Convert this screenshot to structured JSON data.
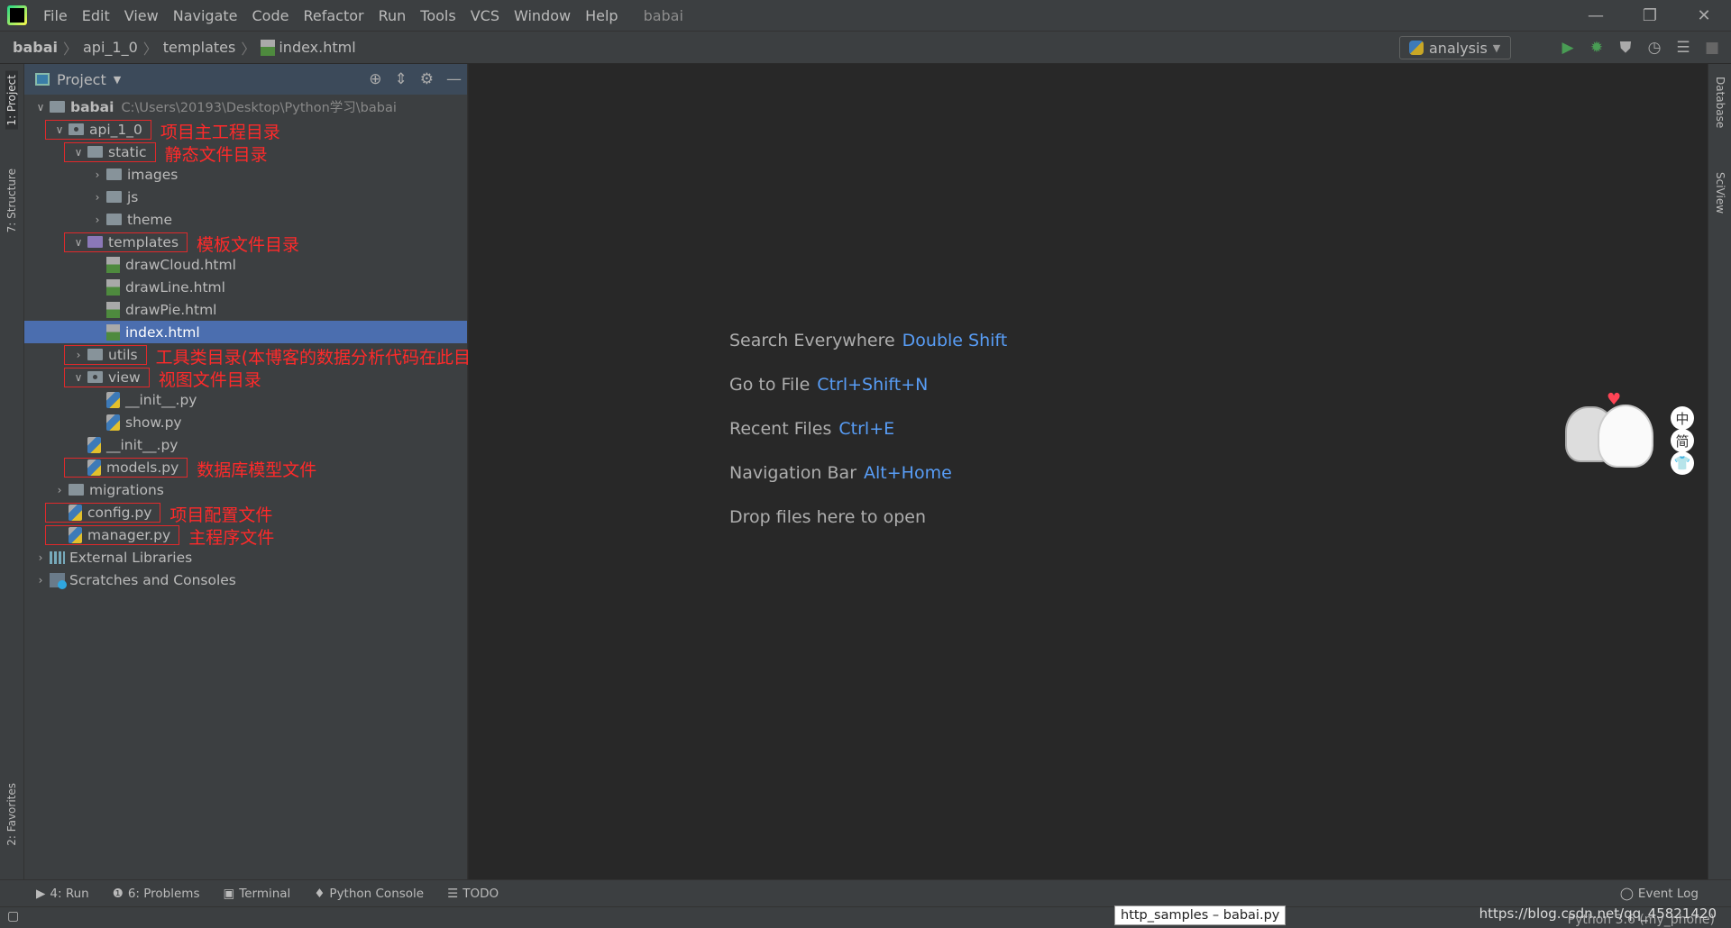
{
  "window": {
    "title": "babai",
    "menus": [
      "File",
      "Edit",
      "View",
      "Navigate",
      "Code",
      "Refactor",
      "Run",
      "Tools",
      "VCS",
      "Window",
      "Help"
    ]
  },
  "breadcrumb": [
    "babai",
    "api_1_0",
    "templates",
    "index.html"
  ],
  "toolbar": {
    "run_config": "analysis"
  },
  "left_stripe": {
    "project": "1: Project",
    "structure": "7: Structure",
    "favorites": "2: Favorites"
  },
  "right_stripe": {
    "database": "Database",
    "sciview": "SciView"
  },
  "project_panel": {
    "title": "Project",
    "root": {
      "name": "babai",
      "path": "C:\\Users\\20193\\Desktop\\Python学习\\babai"
    },
    "rows": [
      {
        "name": "api_1_0",
        "note": "项目主工程目录"
      },
      {
        "name": "static",
        "note": "静态文件目录"
      },
      {
        "name": "images"
      },
      {
        "name": "js"
      },
      {
        "name": "theme"
      },
      {
        "name": "templates",
        "note": "模板文件目录"
      },
      {
        "name": "drawCloud.html"
      },
      {
        "name": "drawLine.html"
      },
      {
        "name": "drawPie.html"
      },
      {
        "name": "index.html"
      },
      {
        "name": "utils",
        "note": "工具类目录(本博客的数据分析代码在此目录的analysis.py文件中)"
      },
      {
        "name": "view",
        "note": "视图文件目录"
      },
      {
        "name": "__init__.py"
      },
      {
        "name": "show.py"
      },
      {
        "name": "__init__.py"
      },
      {
        "name": "models.py",
        "note": "数据库模型文件"
      },
      {
        "name": "migrations"
      },
      {
        "name": "config.py",
        "note": "项目配置文件"
      },
      {
        "name": "manager.py",
        "note": "主程序文件"
      },
      {
        "name": "External Libraries"
      },
      {
        "name": "Scratches and Consoles"
      }
    ]
  },
  "editor": {
    "hints": [
      {
        "label": "Search Everywhere",
        "key": "Double Shift"
      },
      {
        "label": "Go to File",
        "key": "Ctrl+Shift+N"
      },
      {
        "label": "Recent Files",
        "key": "Ctrl+E"
      },
      {
        "label": "Navigation Bar",
        "key": "Alt+Home"
      },
      {
        "label": "Drop files here to open",
        "key": ""
      }
    ]
  },
  "ime": [
    "中",
    "简",
    "👕"
  ],
  "bottom_tools": [
    "4: Run",
    "6: Problems",
    "Terminal",
    "Python Console",
    "TODO"
  ],
  "event_log": "Event Log",
  "status": {
    "tooltip": "http_samples – babai.py",
    "interpreter": "Python 3.6 (my_phone)",
    "watermark": "https://blog.csdn.net/qq_45821420"
  },
  "colors": {
    "selection": "#4b6eaf",
    "annotation": "#e0292b",
    "shortcut": "#589df6"
  }
}
